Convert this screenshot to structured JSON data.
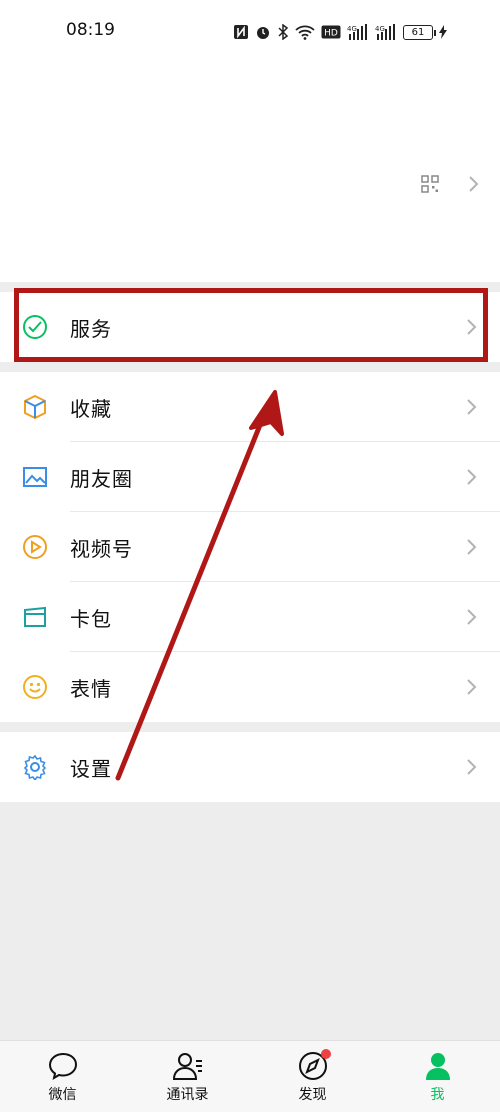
{
  "status_bar": {
    "time": "08:19",
    "battery": "61"
  },
  "menu": {
    "service": "服务",
    "favorites": "收藏",
    "moments": "朋友圈",
    "channels": "视频号",
    "cards": "卡包",
    "stickers": "表情",
    "settings": "设置"
  },
  "tabbar": {
    "chats": "微信",
    "contacts": "通讯录",
    "discover": "发现",
    "me": "我"
  },
  "colors": {
    "accent": "#07c160",
    "highlight": "#b01818",
    "badge": "#f04040"
  }
}
